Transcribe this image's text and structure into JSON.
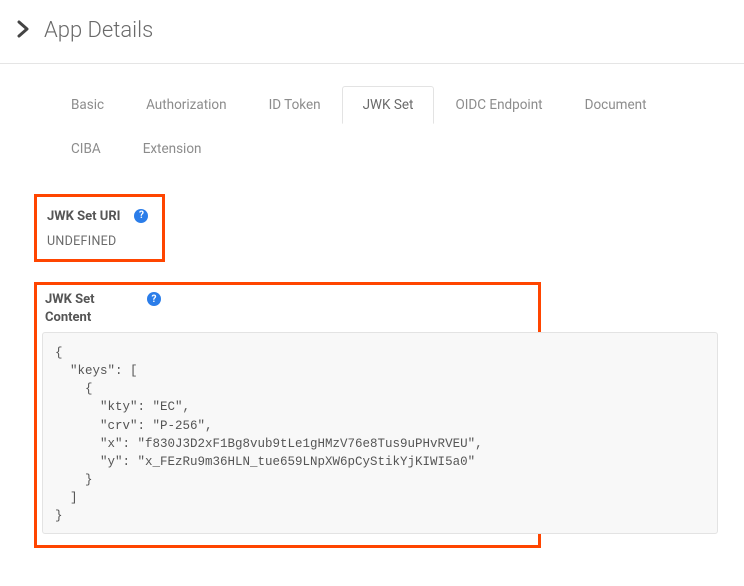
{
  "header": {
    "title": "App Details"
  },
  "tabs": {
    "basic": "Basic",
    "authorization": "Authorization",
    "id_token": "ID Token",
    "jwk_set": "JWK Set",
    "oidc_endpoint": "OIDC Endpoint",
    "document": "Document",
    "ciba": "CIBA",
    "extension": "Extension"
  },
  "jwk_uri": {
    "label": "JWK Set URI",
    "value": "UNDEFINED"
  },
  "jwk_content": {
    "label": "JWK Set Content",
    "code": "{\n  \"keys\": [\n    {\n      \"kty\": \"EC\",\n      \"crv\": \"P-256\",\n      \"x\": \"f830J3D2xF1Bg8vub9tLe1gHMzV76e8Tus9uPHvRVEU\",\n      \"y\": \"x_FEzRu9m36HLN_tue659LNpXW6pCyStikYjKIWI5a0\"\n    }\n  ]\n}"
  }
}
